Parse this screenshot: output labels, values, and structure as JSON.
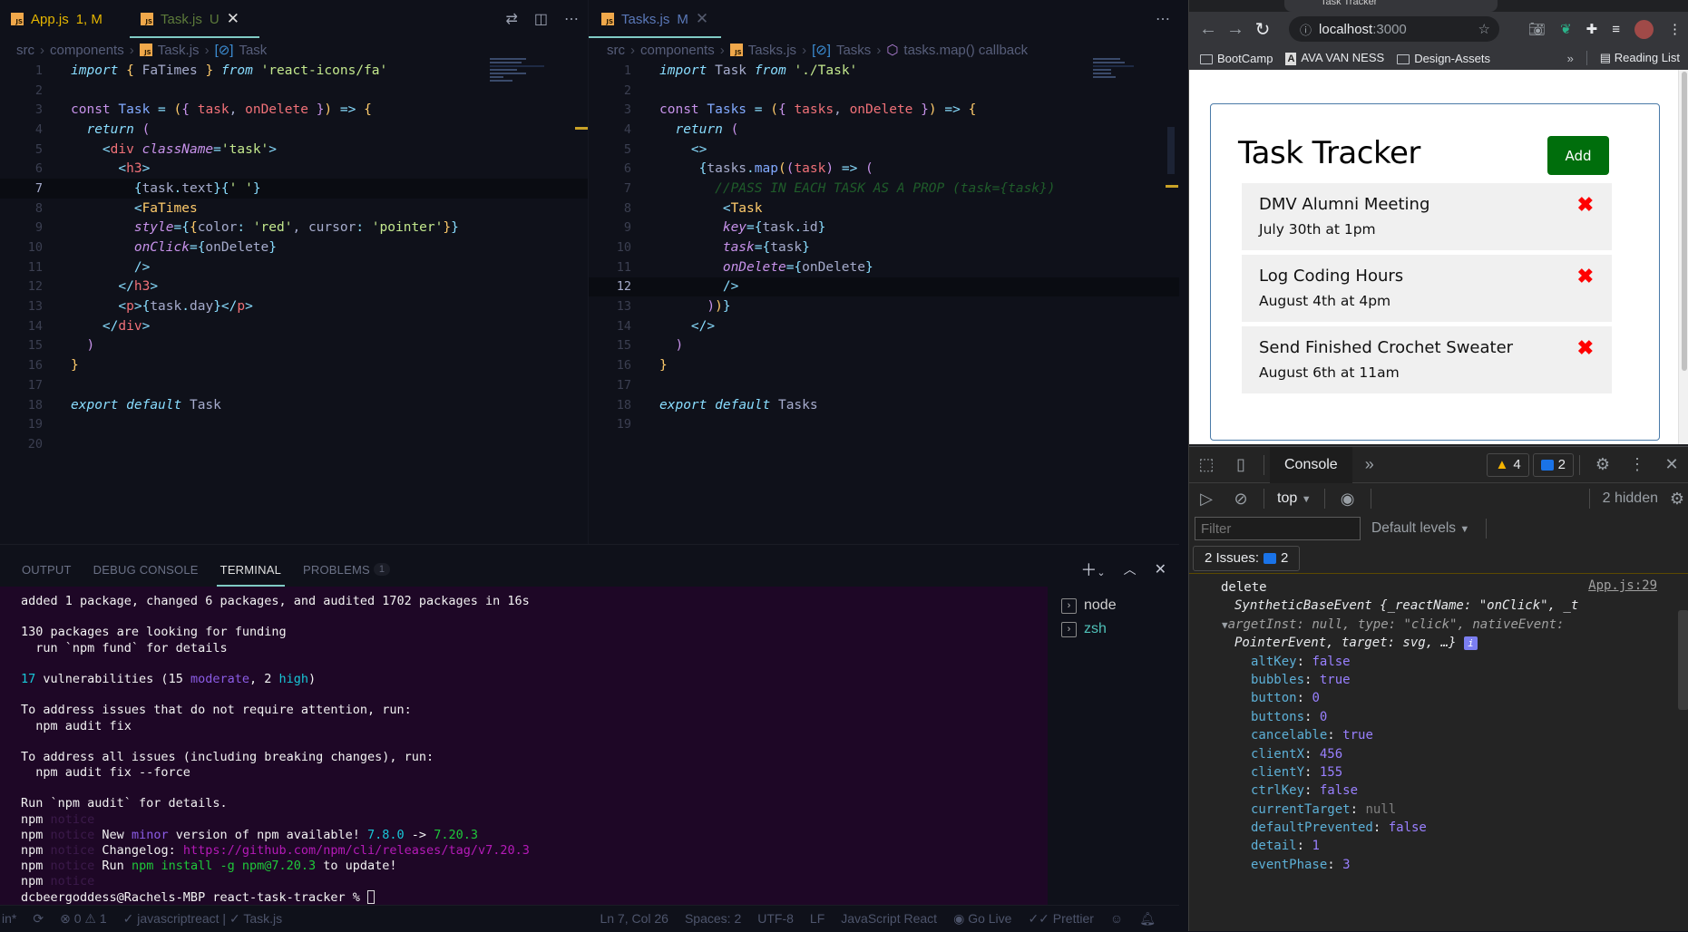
{
  "editor_left": {
    "tabs": [
      {
        "name": "App.js",
        "status": "1, M",
        "active": false
      },
      {
        "name": "Task.js",
        "status": "U",
        "active": true
      }
    ],
    "breadcrumb": [
      "src",
      "components",
      "Task.js",
      "Task"
    ],
    "cursor_line": 7,
    "lines": [
      [
        [
          "k",
          "import"
        ],
        [
          "v",
          " "
        ],
        [
          "y",
          "{"
        ],
        [
          "v",
          " FaTimes "
        ],
        [
          "y",
          "}"
        ],
        [
          "v",
          " "
        ],
        [
          "k",
          "from"
        ],
        [
          "v",
          " "
        ],
        [
          "s",
          "'react-icons/fa'"
        ]
      ],
      [],
      [
        [
          "c",
          "const"
        ],
        [
          "v",
          " "
        ],
        [
          "n",
          "Task"
        ],
        [
          "v",
          " "
        ],
        [
          "b",
          "="
        ],
        [
          "v",
          " "
        ],
        [
          "y",
          "("
        ],
        [
          "pk",
          "{"
        ],
        [
          "v",
          " "
        ],
        [
          "p",
          "task"
        ],
        [
          "v",
          ", "
        ],
        [
          "p",
          "onDelete"
        ],
        [
          "v",
          " "
        ],
        [
          "pk",
          "}"
        ],
        [
          "y",
          ")"
        ],
        [
          "v",
          " "
        ],
        [
          "b",
          "=>"
        ],
        [
          "v",
          " "
        ],
        [
          "y",
          "{"
        ]
      ],
      [
        [
          "v",
          "  "
        ],
        [
          "k",
          "return"
        ],
        [
          "v",
          " "
        ],
        [
          "pk",
          "("
        ]
      ],
      [
        [
          "v",
          "    "
        ],
        [
          "b",
          "<"
        ],
        [
          "r",
          "div"
        ],
        [
          "v",
          " "
        ],
        [
          "g",
          "className"
        ],
        [
          "b",
          "="
        ],
        [
          "s",
          "'task'"
        ],
        [
          "b",
          ">"
        ]
      ],
      [
        [
          "v",
          "      "
        ],
        [
          "b",
          "<"
        ],
        [
          "r",
          "h3"
        ],
        [
          "b",
          ">"
        ]
      ],
      [
        [
          "v",
          "        "
        ],
        [
          "b",
          "{"
        ],
        [
          "v",
          "task"
        ],
        [
          "b",
          "."
        ],
        [
          "v",
          "text"
        ],
        [
          "b",
          "}{"
        ],
        [
          "s",
          "' '"
        ],
        [
          "b",
          "}"
        ]
      ],
      [
        [
          "v",
          "        "
        ],
        [
          "b",
          "<"
        ],
        [
          "y",
          "FaTimes"
        ]
      ],
      [
        [
          "v",
          "        "
        ],
        [
          "g",
          "style"
        ],
        [
          "b",
          "="
        ],
        [
          "b",
          "{"
        ],
        [
          "y",
          "{"
        ],
        [
          "v",
          "color"
        ],
        [
          "b",
          ":"
        ],
        [
          "v",
          " "
        ],
        [
          "s",
          "'red'"
        ],
        [
          "v",
          ", cursor"
        ],
        [
          "b",
          ":"
        ],
        [
          "v",
          " "
        ],
        [
          "s",
          "'pointer'"
        ],
        [
          "y",
          "}"
        ],
        [
          "b",
          "}"
        ]
      ],
      [
        [
          "v",
          "        "
        ],
        [
          "g",
          "onClick"
        ],
        [
          "b",
          "="
        ],
        [
          "b",
          "{"
        ],
        [
          "v",
          "onDelete"
        ],
        [
          "b",
          "}"
        ]
      ],
      [
        [
          "v",
          "        "
        ],
        [
          "b",
          "/>"
        ]
      ],
      [
        [
          "v",
          "      "
        ],
        [
          "b",
          "</"
        ],
        [
          "r",
          "h3"
        ],
        [
          "b",
          ">"
        ]
      ],
      [
        [
          "v",
          "      "
        ],
        [
          "b",
          "<"
        ],
        [
          "r",
          "p"
        ],
        [
          "b",
          ">"
        ],
        [
          "b",
          "{"
        ],
        [
          "v",
          "task"
        ],
        [
          "b",
          "."
        ],
        [
          "v",
          "day"
        ],
        [
          "b",
          "}"
        ],
        [
          "b",
          "</"
        ],
        [
          "r",
          "p"
        ],
        [
          "b",
          ">"
        ]
      ],
      [
        [
          "v",
          "    "
        ],
        [
          "b",
          "</"
        ],
        [
          "r",
          "div"
        ],
        [
          "b",
          ">"
        ]
      ],
      [
        [
          "v",
          "  "
        ],
        [
          "pk",
          ")"
        ]
      ],
      [
        [
          "y",
          "}"
        ]
      ],
      [],
      [
        [
          "k",
          "export"
        ],
        [
          "v",
          " "
        ],
        [
          "k",
          "default"
        ],
        [
          "v",
          " Task"
        ]
      ],
      [],
      []
    ]
  },
  "editor_right": {
    "tabs": [
      {
        "name": "Tasks.js",
        "status": "M",
        "active": true
      }
    ],
    "breadcrumb": [
      "src",
      "components",
      "Tasks.js",
      "Tasks",
      "tasks.map() callback"
    ],
    "cursor_line": 12,
    "lines": [
      [
        [
          "k",
          "import"
        ],
        [
          "v",
          " Task "
        ],
        [
          "k",
          "from"
        ],
        [
          "v",
          " "
        ],
        [
          "s",
          "'./Task'"
        ]
      ],
      [],
      [
        [
          "c",
          "const"
        ],
        [
          "v",
          " "
        ],
        [
          "n",
          "Tasks"
        ],
        [
          "v",
          " "
        ],
        [
          "b",
          "="
        ],
        [
          "v",
          " "
        ],
        [
          "y",
          "("
        ],
        [
          "pk",
          "{"
        ],
        [
          "v",
          " "
        ],
        [
          "p",
          "tasks"
        ],
        [
          "v",
          ", "
        ],
        [
          "p",
          "onDelete"
        ],
        [
          "v",
          " "
        ],
        [
          "pk",
          "}"
        ],
        [
          "y",
          ")"
        ],
        [
          "v",
          " "
        ],
        [
          "b",
          "=>"
        ],
        [
          "v",
          " "
        ],
        [
          "y",
          "{"
        ]
      ],
      [
        [
          "v",
          "  "
        ],
        [
          "k",
          "return"
        ],
        [
          "v",
          " "
        ],
        [
          "pk",
          "("
        ]
      ],
      [
        [
          "v",
          "    "
        ],
        [
          "b",
          "<>"
        ]
      ],
      [
        [
          "v",
          "     "
        ],
        [
          "b",
          "{"
        ],
        [
          "v",
          "tasks"
        ],
        [
          "b",
          "."
        ],
        [
          "n",
          "map"
        ],
        [
          "y",
          "("
        ],
        [
          "pk",
          "("
        ],
        [
          "p",
          "task"
        ],
        [
          "pk",
          ")"
        ],
        [
          "v",
          " "
        ],
        [
          "b",
          "=>"
        ],
        [
          "v",
          " "
        ],
        [
          "pk",
          "("
        ]
      ],
      [
        [
          "v",
          "       "
        ],
        [
          "cm",
          "//PASS IN EACH TASK AS A PROP (task={task})"
        ]
      ],
      [
        [
          "v",
          "        "
        ],
        [
          "b",
          "<"
        ],
        [
          "y",
          "Task"
        ]
      ],
      [
        [
          "v",
          "        "
        ],
        [
          "g",
          "key"
        ],
        [
          "b",
          "="
        ],
        [
          "b",
          "{"
        ],
        [
          "v",
          "task"
        ],
        [
          "b",
          "."
        ],
        [
          "v",
          "id"
        ],
        [
          "b",
          "}"
        ]
      ],
      [
        [
          "v",
          "        "
        ],
        [
          "g",
          "task"
        ],
        [
          "b",
          "="
        ],
        [
          "b",
          "{"
        ],
        [
          "v",
          "task"
        ],
        [
          "b",
          "}"
        ]
      ],
      [
        [
          "v",
          "        "
        ],
        [
          "g",
          "onDelete"
        ],
        [
          "b",
          "="
        ],
        [
          "b",
          "{"
        ],
        [
          "v",
          "onDelete"
        ],
        [
          "b",
          "}"
        ]
      ],
      [
        [
          "v",
          "        "
        ],
        [
          "b",
          "/>"
        ]
      ],
      [
        [
          "v",
          "      "
        ],
        [
          "pk",
          ")"
        ],
        [
          "y",
          ")"
        ],
        [
          "b",
          "}"
        ]
      ],
      [
        [
          "v",
          "    "
        ],
        [
          "b",
          "</>"
        ]
      ],
      [
        [
          "v",
          "  "
        ],
        [
          "pk",
          ")"
        ]
      ],
      [
        [
          "y",
          "}"
        ]
      ],
      [],
      [
        [
          "k",
          "export"
        ],
        [
          "v",
          " "
        ],
        [
          "k",
          "default"
        ],
        [
          "v",
          " Tasks"
        ]
      ],
      []
    ]
  },
  "panel": {
    "tabs": [
      {
        "label": "OUTPUT",
        "active": false
      },
      {
        "label": "DEBUG CONSOLE",
        "active": false
      },
      {
        "label": "TERMINAL",
        "active": true
      },
      {
        "label": "PROBLEMS",
        "active": false,
        "badge": "1"
      }
    ],
    "terminal_lines": [
      [
        [
          "w",
          "added 1 package, changed 6 packages, and audited 1702 packages in 16s"
        ]
      ],
      [],
      [
        [
          "w",
          "130 packages are looking for funding"
        ]
      ],
      [
        [
          "w",
          "  run `npm fund` for details"
        ]
      ],
      [],
      [
        [
          "cy",
          "17"
        ],
        [
          "w",
          " vulnerabilities (15 "
        ],
        [
          "pu",
          "moderate"
        ],
        [
          "w",
          ", 2 "
        ],
        [
          "cy",
          "high"
        ],
        [
          "w",
          ")"
        ]
      ],
      [],
      [
        [
          "w",
          "To address issues that do not require attention, run:"
        ]
      ],
      [
        [
          "w",
          "  npm audit fix"
        ]
      ],
      [],
      [
        [
          "w",
          "To address all issues (including breaking changes), run:"
        ]
      ],
      [
        [
          "w",
          "  npm audit fix --force"
        ]
      ],
      [],
      [
        [
          "w",
          "Run `npm audit` for details."
        ]
      ],
      [
        [
          "w",
          "npm "
        ],
        [
          "dim",
          "notice"
        ]
      ],
      [
        [
          "w",
          "npm "
        ],
        [
          "dim",
          "notice"
        ],
        [
          "w",
          " New "
        ],
        [
          "pu",
          "minor"
        ],
        [
          "w",
          " version of npm available! "
        ],
        [
          "cy",
          "7.8.0"
        ],
        [
          "w",
          " -> "
        ],
        [
          "gr",
          "7.20.3"
        ]
      ],
      [
        [
          "w",
          "npm "
        ],
        [
          "dim",
          "notice"
        ],
        [
          "w",
          " Changelog: "
        ],
        [
          "mg",
          "https://github.com/npm/cli/releases/tag/v7.20.3"
        ]
      ],
      [
        [
          "w",
          "npm "
        ],
        [
          "dim",
          "notice"
        ],
        [
          "w",
          " Run "
        ],
        [
          "gr",
          "npm install -g npm@7.20.3"
        ],
        [
          "w",
          " to update!"
        ]
      ],
      [
        [
          "w",
          "npm "
        ],
        [
          "dim",
          "notice"
        ]
      ],
      [
        [
          "w",
          "dcbeergoddess@Rachels-MBP react-task-tracker % "
        ]
      ]
    ],
    "sessions": [
      {
        "name": "node",
        "active": false
      },
      {
        "name": "zsh",
        "active": true
      }
    ]
  },
  "statusbar": {
    "branch_fragment": "in*",
    "errors": "0",
    "warnings": "1",
    "checks": "✓ javascriptreact | ✓ Task.js",
    "position": "Ln 7, Col 26",
    "spaces": "Spaces: 2",
    "encoding": "UTF-8",
    "eol": "LF",
    "language": "JavaScript React",
    "go_live": "Go Live",
    "prettier": "Prettier"
  },
  "browser": {
    "tab_title": "Task Tracker",
    "url_host": "localhost",
    "url_port": ":3000",
    "bookmarks": [
      {
        "label": "BootCamp",
        "icon": "folder-icon"
      },
      {
        "label": "AVA VAN NESS",
        "icon": "site-icon"
      },
      {
        "label": "Design-Assets",
        "icon": "folder-icon"
      }
    ],
    "overflow": "»",
    "reading_list": "Reading List",
    "app": {
      "title": "Task Tracker",
      "add_label": "Add",
      "tasks": [
        {
          "text": "DMV Alumni Meeting",
          "day": "July 30th at 1pm"
        },
        {
          "text": "Log Coding Hours",
          "day": "August 4th at 4pm"
        },
        {
          "text": "Send Finished Crochet Sweater",
          "day": "August 6th at 11am"
        }
      ]
    },
    "devtools": {
      "active_tab": "Console",
      "warnings_count": "4",
      "messages_count": "2",
      "context": "top",
      "hidden": "2 hidden",
      "filter_placeholder": "Filter",
      "levels": "Default levels",
      "issues_label": "2 Issues:",
      "issues_count": "2",
      "log_label": "delete",
      "source": "App.js:29",
      "summary_1": "SyntheticBaseEvent {_reactName: \"onClick\", _t",
      "summary_2": "argetInst: null, type: \"click\", nativeEvent:",
      "summary_3": "PointerEvent, target: svg, …}",
      "props": [
        {
          "key": "altKey",
          "value": "false",
          "kind": "val"
        },
        {
          "key": "bubbles",
          "value": "true",
          "kind": "val"
        },
        {
          "key": "button",
          "value": "0",
          "kind": "val"
        },
        {
          "key": "buttons",
          "value": "0",
          "kind": "val"
        },
        {
          "key": "cancelable",
          "value": "true",
          "kind": "val"
        },
        {
          "key": "clientX",
          "value": "456",
          "kind": "val"
        },
        {
          "key": "clientY",
          "value": "155",
          "kind": "val"
        },
        {
          "key": "ctrlKey",
          "value": "false",
          "kind": "val"
        },
        {
          "key": "currentTarget",
          "value": "null",
          "kind": "nullv"
        },
        {
          "key": "defaultPrevented",
          "value": "false",
          "kind": "val"
        },
        {
          "key": "detail",
          "value": "1",
          "kind": "val"
        },
        {
          "key": "eventPhase",
          "value": "3",
          "kind": "val"
        }
      ]
    }
  },
  "colors": {
    "editor_bg": "#0f111a",
    "terminal_bg": "#1e0726",
    "accent": "#80cbc4",
    "add_button": "#006e0c",
    "delete_icon": "#ff0000"
  }
}
